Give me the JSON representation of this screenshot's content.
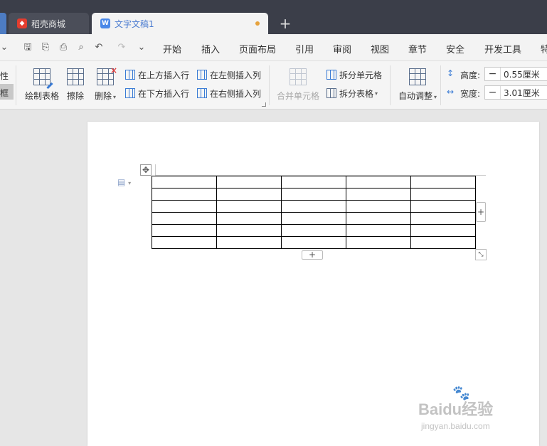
{
  "tabs": [
    {
      "label": "稻壳商城",
      "icon": "daoke-logo-icon"
    },
    {
      "label": "文字文稿1",
      "icon": "wps-writer-icon",
      "unsaved": true
    }
  ],
  "quick_access": [
    "save-icon",
    "format-painter-icon",
    "print-icon",
    "print-preview-icon",
    "undo-icon",
    "redo-icon",
    "customize-icon"
  ],
  "menu": [
    "开始",
    "插入",
    "页面布局",
    "引用",
    "审阅",
    "视图",
    "章节",
    "安全",
    "开发工具",
    "特"
  ],
  "ribbon": {
    "stub_top": "性",
    "stub_bottom": "框",
    "draw_table": "绘制表格",
    "erase": "擦除",
    "delete": "删除",
    "insert_above": "在上方插入行",
    "insert_below": "在下方插入行",
    "insert_left": "在左侧插入列",
    "insert_right": "在右侧插入列",
    "merge_cells": "合并单元格",
    "split_cells": "拆分单元格",
    "split_table": "拆分表格",
    "auto_fit": "自动调整",
    "height_label": "高度:",
    "height_value": "0.55厘米",
    "width_label": "宽度:",
    "width_value": "3.01厘米",
    "minus": "−"
  },
  "table": {
    "rows": 6,
    "cols": 5
  },
  "document": {
    "move_handle": "✥",
    "add_col": "+",
    "add_row": "+",
    "resize": "⤡",
    "para_icon": "▤"
  },
  "watermark": {
    "main": "Baidu经验",
    "sub": "jingyan.baidu.com"
  },
  "colors": {
    "tab_bar": "#3b3e49",
    "accent": "#4a7bd0",
    "unsaved_dot": "#e6a23c"
  }
}
